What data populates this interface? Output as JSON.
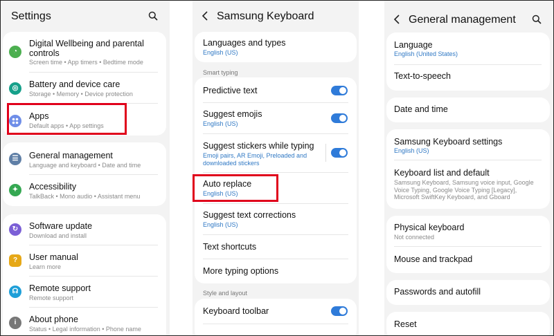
{
  "settings": {
    "title": "Settings",
    "search_icon": "search-icon",
    "items": [
      {
        "label": "Digital Wellbeing and parental controls",
        "label_l1": "Digital Wellbeing and parental",
        "label_l2": "controls",
        "sub": "Screen time  •  App timers  •  Bedtime mode",
        "icon": "wellbeing-icon",
        "color": "#4caf50"
      },
      {
        "label": "Battery and device care",
        "sub": "Storage  •  Memory  •  Device protection",
        "icon": "device-care-icon",
        "color": "#16a08a"
      },
      {
        "label": "Apps",
        "sub": "Default apps  •  App settings",
        "icon": "apps-icon",
        "color": "#6f8ee8"
      },
      {
        "label": "General management",
        "sub": "Language and keyboard  •  Date and time",
        "icon": "general-management-icon",
        "color": "#5f7fa6"
      },
      {
        "label": "Accessibility",
        "sub": "TalkBack  •  Mono audio  •  Assistant menu",
        "icon": "accessibility-icon",
        "color": "#35a852"
      },
      {
        "label": "Software update",
        "sub": "Download and install",
        "icon": "software-update-icon",
        "color": "#7b5fd6"
      },
      {
        "label": "User manual",
        "sub": "Learn more",
        "icon": "user-manual-icon",
        "color": "#e6a817"
      },
      {
        "label": "Remote support",
        "sub": "Remote support",
        "icon": "remote-support-icon",
        "color": "#1e9fd8"
      },
      {
        "label": "About phone",
        "sub": "Status  •  Legal information  •  Phone name",
        "icon": "about-phone-icon",
        "color": "#777777"
      }
    ]
  },
  "keyboard": {
    "title": "Samsung Keyboard",
    "back_icon": "back-arrow-icon",
    "languages": {
      "label": "Languages and types",
      "sub": "English (US)"
    },
    "section_smart": "Smart typing",
    "predictive": {
      "label": "Predictive text",
      "on": true
    },
    "emojis": {
      "label": "Suggest emojis",
      "sub": "English (US)",
      "on": true
    },
    "stickers": {
      "label": "Suggest stickers while typing",
      "sub_l1": "Emoji pairs, AR Emoji, Preloaded and",
      "sub_l2": "downloaded stickers",
      "on": true
    },
    "auto_replace": {
      "label": "Auto replace",
      "sub": "English (US)"
    },
    "corrections": {
      "label": "Suggest text corrections",
      "sub": "English (US)"
    },
    "shortcuts": {
      "label": "Text shortcuts"
    },
    "more_options": {
      "label": "More typing options"
    },
    "section_style": "Style and layout",
    "toolbar": {
      "label": "Keyboard toolbar",
      "on": true
    }
  },
  "general": {
    "title": "General management",
    "back_icon": "back-arrow-icon",
    "search_icon": "search-icon",
    "language": {
      "label": "Language",
      "sub": "English (United States)"
    },
    "tts": {
      "label": "Text-to-speech"
    },
    "datetime": {
      "label": "Date and time"
    },
    "kb_settings": {
      "label": "Samsung Keyboard settings",
      "sub": "English (US)"
    },
    "kb_list": {
      "label": "Keyboard list and default",
      "desc_l1": "Samsung Keyboard, Samsung voice input, Google",
      "desc_l2": "Voice Typing, Google Voice Typing [Legacy],",
      "desc_l3": "Microsoft SwiftKey Keyboard, and Gboard"
    },
    "physical": {
      "label": "Physical keyboard",
      "sub": "Not connected"
    },
    "mouse": {
      "label": "Mouse and trackpad"
    },
    "passwords": {
      "label": "Passwords and autofill"
    },
    "reset": {
      "label": "Reset"
    }
  },
  "colors": {
    "highlight": "#e0001b",
    "toggle_on": "#2f7bd9",
    "link_blue": "#2f78c4"
  }
}
